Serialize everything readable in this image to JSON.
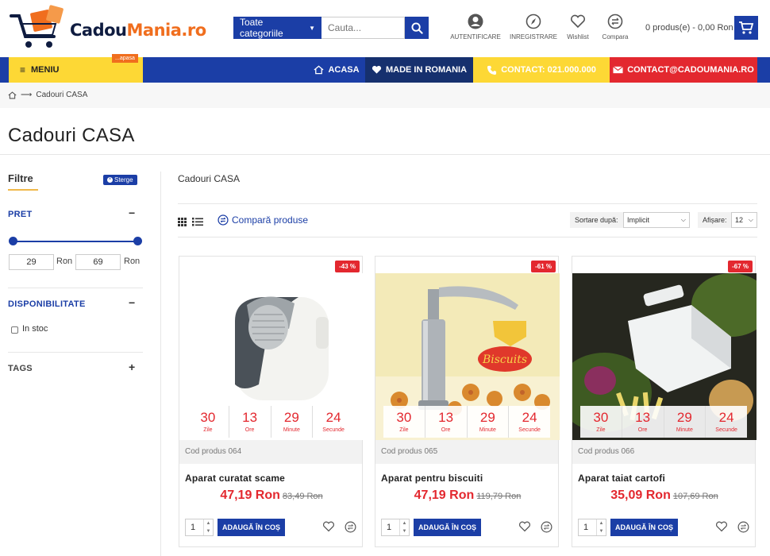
{
  "header": {
    "logo_part1": "Cadou",
    "logo_part2": "Mania.ro",
    "search_category": "Toate categoriile",
    "search_placeholder": "Cauta...",
    "icons": [
      {
        "label": "AUTENTIFICARE",
        "icon": "user-icon"
      },
      {
        "label": "INREGISTRARE",
        "icon": "compass-icon"
      },
      {
        "label": "Wishlist",
        "icon": "heart-icon"
      },
      {
        "label": "Compara",
        "icon": "compare-icon"
      }
    ],
    "cart_summary": "0 produs(e) - 0,00 Ron"
  },
  "nav": {
    "menu_label": "MENIU",
    "menu_badge": "...apasa",
    "items": [
      {
        "label": "ACASA",
        "icon": "home-icon"
      },
      {
        "label": "MADE IN ROMANIA",
        "icon": "heart-icon"
      },
      {
        "label": "CONTACT: 021.000.000",
        "icon": "phone-icon"
      },
      {
        "label": "CONTACT@CADOUMANIA.RO",
        "icon": "mail-icon"
      }
    ],
    "colors": {
      "bar": "#1b3ea6",
      "menu": "#fdd835",
      "made": "#16306e",
      "contact_phone": "#fdd835",
      "contact_mail": "#e3282f"
    }
  },
  "breadcrumb": {
    "current": "Cadouri CASA"
  },
  "page_title": "Cadouri CASA",
  "sidebar": {
    "filter_title": "Filtre",
    "clear_label": "Sterge",
    "price": {
      "title": "PRET",
      "min": "29",
      "max": "69",
      "unit": "Ron"
    },
    "availability": {
      "title": "DISPONIBILITATE",
      "option": "In stoc"
    },
    "tags": {
      "title": "TAGS"
    }
  },
  "main": {
    "crumb": "Cadouri CASA",
    "compare_label": "Compară produse",
    "sort_label": "Sortare după:",
    "sort_value": "Implicit",
    "show_label": "Afișare:",
    "show_value": "12"
  },
  "countdown_labels": [
    "Zile",
    "Ore",
    "Minute",
    "Secunde"
  ],
  "products": [
    {
      "badge": "-43 %",
      "code": "Cod produs 064",
      "name": "Aparat curatat scame",
      "price_new": "47,19 Ron",
      "price_old": "83,49 Ron",
      "countdown": [
        "30",
        "13",
        "29",
        "24"
      ],
      "qty": "1",
      "add_label": "ADAUGĂ ÎN COȘ"
    },
    {
      "badge": "-61 %",
      "code": "Cod produs 065",
      "name": "Aparat pentru biscuiti",
      "price_new": "47,19 Ron",
      "price_old": "119,79 Ron",
      "countdown": [
        "30",
        "13",
        "29",
        "24"
      ],
      "qty": "1",
      "add_label": "ADAUGĂ ÎN COȘ"
    },
    {
      "badge": "-67 %",
      "code": "Cod produs 066",
      "name": "Aparat taiat cartofi",
      "price_new": "35,09 Ron",
      "price_old": "107,69 Ron",
      "countdown": [
        "30",
        "13",
        "29",
        "24"
      ],
      "qty": "1",
      "add_label": "ADAUGĂ ÎN COȘ"
    }
  ]
}
